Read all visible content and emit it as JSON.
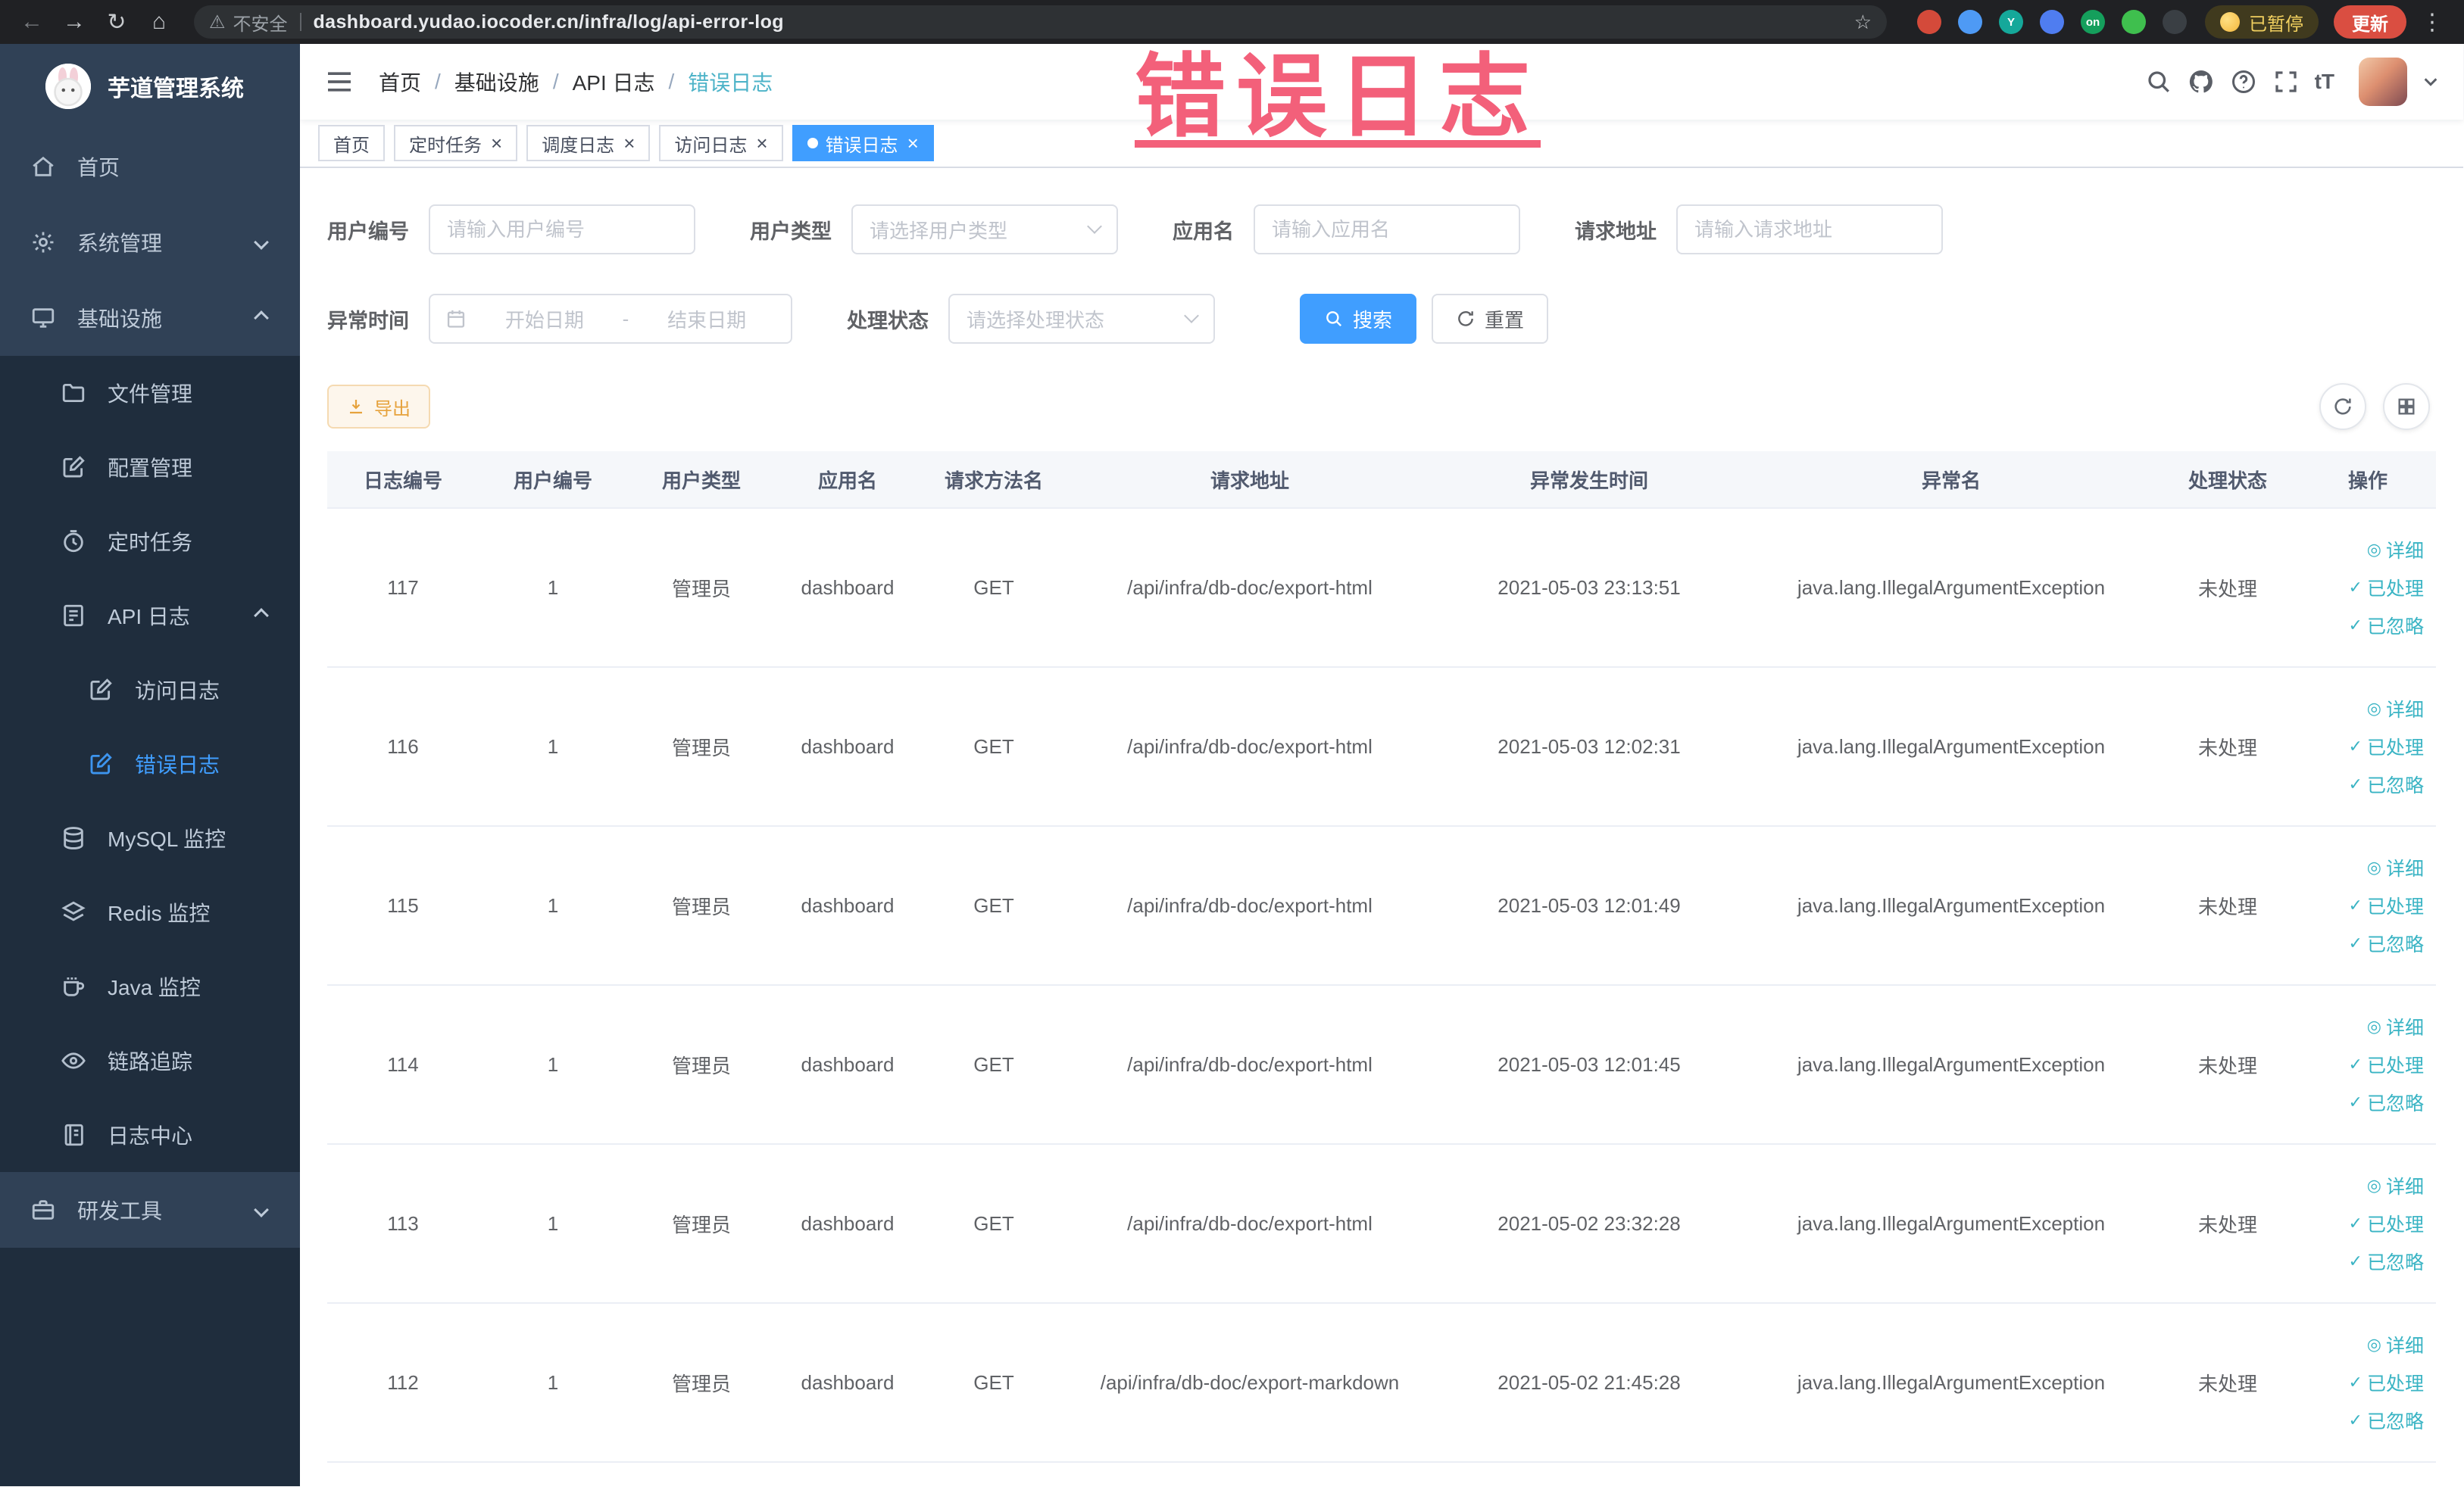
{
  "browser": {
    "security_label": "不安全",
    "url": "dashboard.yudao.iocoder.cn/infra/log/api-error-log",
    "paused_badge": "已暂停",
    "update_button": "更新",
    "glyphs": {
      "back": "←",
      "forward": "→",
      "refresh": "↻",
      "home": "⌂",
      "warning": "⚠",
      "star": "☆",
      "menu": "⋮"
    },
    "extensions": [
      {
        "name": "extension-red-circle-icon",
        "color": "#d44a3a",
        "glyph": ""
      },
      {
        "name": "extension-blue-drop-icon",
        "color": "#4e9af5",
        "glyph": ""
      },
      {
        "name": "extension-teal-y-icon",
        "color": "#15a89a",
        "glyph": "Y"
      },
      {
        "name": "extension-blue-grid-icon",
        "color": "#4f7df0",
        "glyph": ""
      },
      {
        "name": "extension-green-on-icon",
        "color": "#159f5c",
        "glyph": "on"
      },
      {
        "name": "extension-green-leaf-icon",
        "color": "#3fbf4e",
        "glyph": ""
      },
      {
        "name": "extension-dark-paw-icon",
        "color": "#3a3f44",
        "glyph": ""
      }
    ]
  },
  "overlay": {
    "annotation": "错误日志"
  },
  "sidebar": {
    "logo_title": "芋道管理系统",
    "items": [
      {
        "key": "home",
        "label": "首页",
        "icon": "home",
        "level": 1,
        "sub": false
      },
      {
        "key": "system",
        "label": "系统管理",
        "icon": "gear",
        "level": 1,
        "arrow": "down",
        "sub": false
      },
      {
        "key": "infrastructure",
        "label": "基础设施",
        "icon": "monitor",
        "level": 1,
        "arrow": "up",
        "sub": false
      },
      {
        "key": "file-management",
        "label": "文件管理",
        "icon": "folder",
        "level": 2,
        "sub": true
      },
      {
        "key": "config-management",
        "label": "配置管理",
        "icon": "edit",
        "level": 2,
        "sub": true
      },
      {
        "key": "scheduled-jobs",
        "label": "定时任务",
        "icon": "timer",
        "level": 2,
        "sub": true
      },
      {
        "key": "api-log",
        "label": "API 日志",
        "icon": "doc",
        "level": 2,
        "arrow": "up",
        "sub": true
      },
      {
        "key": "access-log",
        "label": "访问日志",
        "icon": "edit",
        "level": 3,
        "sub": true
      },
      {
        "key": "error-log",
        "label": "错误日志",
        "icon": "edit",
        "level": 3,
        "active": true,
        "sub": true
      },
      {
        "key": "mysql-monitor",
        "label": "MySQL 监控",
        "icon": "db",
        "level": 2,
        "sub": true
      },
      {
        "key": "redis-monitor",
        "label": "Redis 监控",
        "icon": "layers",
        "level": 2,
        "sub": true
      },
      {
        "key": "java-monitor",
        "label": "Java 监控",
        "icon": "coffee",
        "level": 2,
        "sub": true
      },
      {
        "key": "trace",
        "label": "链路追踪",
        "icon": "eye",
        "level": 2,
        "sub": true
      },
      {
        "key": "log-center",
        "label": "日志中心",
        "icon": "notebook",
        "level": 2,
        "sub": true
      },
      {
        "key": "dev-tools",
        "label": "研发工具",
        "icon": "briefcase",
        "level": 1,
        "arrow": "down",
        "sub": false
      }
    ]
  },
  "header": {
    "breadcrumb": [
      "首页",
      "基础设施",
      "API 日志",
      "错误日志"
    ],
    "text_size_glyph": "tT"
  },
  "tabs": [
    {
      "key": "home",
      "label": "首页",
      "closable": false,
      "active": false
    },
    {
      "key": "scheduled-jobs",
      "label": "定时任务",
      "closable": true,
      "active": false
    },
    {
      "key": "job-log",
      "label": "调度日志",
      "closable": true,
      "active": false
    },
    {
      "key": "access-log",
      "label": "访问日志",
      "closable": true,
      "active": false
    },
    {
      "key": "error-log",
      "label": "错误日志",
      "closable": true,
      "active": true
    }
  ],
  "filters": {
    "user_id": {
      "label": "用户编号",
      "placeholder": "请输入用户编号"
    },
    "user_type": {
      "label": "用户类型",
      "placeholder": "请选择用户类型"
    },
    "app_name": {
      "label": "应用名",
      "placeholder": "请输入应用名"
    },
    "request_url": {
      "label": "请求地址",
      "placeholder": "请输入请求地址"
    },
    "exception_time": {
      "label": "异常时间",
      "start_placeholder": "开始日期",
      "separator": "-",
      "end_placeholder": "结束日期"
    },
    "process_status": {
      "label": "处理状态",
      "placeholder": "请选择处理状态"
    },
    "search_button": "搜索",
    "reset_button": "重置"
  },
  "toolbar": {
    "export_button": "导出"
  },
  "table": {
    "columns": [
      "日志编号",
      "用户编号",
      "用户类型",
      "应用名",
      "请求方法名",
      "请求地址",
      "异常发生时间",
      "异常名",
      "处理状态",
      "操作"
    ],
    "rows": [
      {
        "id": "117",
        "user_id": "1",
        "user_type": "管理员",
        "app": "dashboard",
        "method": "GET",
        "url": "/api/infra/db-doc/export-html",
        "time": "2021-05-03 23:13:51",
        "exception": "java.lang.IllegalArgumentException",
        "status": "未处理"
      },
      {
        "id": "116",
        "user_id": "1",
        "user_type": "管理员",
        "app": "dashboard",
        "method": "GET",
        "url": "/api/infra/db-doc/export-html",
        "time": "2021-05-03 12:02:31",
        "exception": "java.lang.IllegalArgumentException",
        "status": "未处理"
      },
      {
        "id": "115",
        "user_id": "1",
        "user_type": "管理员",
        "app": "dashboard",
        "method": "GET",
        "url": "/api/infra/db-doc/export-html",
        "time": "2021-05-03 12:01:49",
        "exception": "java.lang.IllegalArgumentException",
        "status": "未处理"
      },
      {
        "id": "114",
        "user_id": "1",
        "user_type": "管理员",
        "app": "dashboard",
        "method": "GET",
        "url": "/api/infra/db-doc/export-html",
        "time": "2021-05-03 12:01:45",
        "exception": "java.lang.IllegalArgumentException",
        "status": "未处理"
      },
      {
        "id": "113",
        "user_id": "1",
        "user_type": "管理员",
        "app": "dashboard",
        "method": "GET",
        "url": "/api/infra/db-doc/export-html",
        "time": "2021-05-02 23:32:28",
        "exception": "java.lang.IllegalArgumentException",
        "status": "未处理"
      },
      {
        "id": "112",
        "user_id": "1",
        "user_type": "管理员",
        "app": "dashboard",
        "method": "GET",
        "url": "/api/infra/db-doc/export-markdown",
        "time": "2021-05-02 21:45:28",
        "exception": "java.lang.IllegalArgumentException",
        "status": "未处理"
      }
    ],
    "actions": [
      {
        "key": "detail",
        "label": "详细",
        "icon": "◎"
      },
      {
        "key": "processed",
        "label": "已处理",
        "icon": "✓"
      },
      {
        "key": "ignored",
        "label": "已忽略",
        "icon": "✓"
      }
    ]
  },
  "colors": {
    "primary": "#409eff",
    "action_link": "#3ab4c4",
    "warning_button": "#e6a23c",
    "annotation_pink": "#f2536f",
    "sidebar_bg": "#304156",
    "submenu_bg": "#1f2d3d",
    "active_tab_bg": "#409eff"
  }
}
